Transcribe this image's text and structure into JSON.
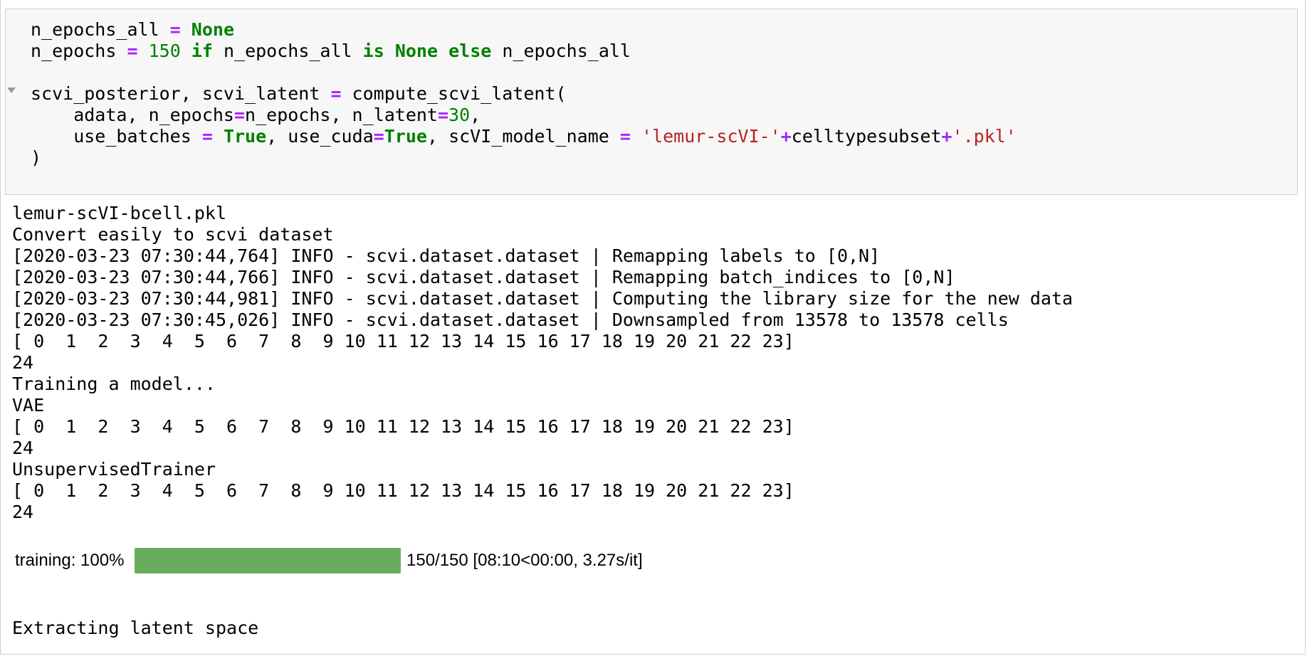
{
  "input": {
    "lines": [
      [
        {
          "t": "n_epochs_all "
        },
        {
          "t": "=",
          "c": "op"
        },
        {
          "t": " "
        },
        {
          "t": "None",
          "c": "kw"
        }
      ],
      [
        {
          "t": "n_epochs "
        },
        {
          "t": "=",
          "c": "op"
        },
        {
          "t": " "
        },
        {
          "t": "150",
          "c": "num"
        },
        {
          "t": " "
        },
        {
          "t": "if",
          "c": "kw"
        },
        {
          "t": " n_epochs_all "
        },
        {
          "t": "is",
          "c": "kw"
        },
        {
          "t": " "
        },
        {
          "t": "None",
          "c": "kw"
        },
        {
          "t": " "
        },
        {
          "t": "else",
          "c": "kw"
        },
        {
          "t": " n_epochs_all"
        }
      ],
      [],
      [
        {
          "t": "scvi_posterior, scvi_latent "
        },
        {
          "t": "=",
          "c": "op"
        },
        {
          "t": " compute_scvi_latent("
        }
      ],
      [
        {
          "t": "    adata, n_epochs"
        },
        {
          "t": "=",
          "c": "op"
        },
        {
          "t": "n_epochs, n_latent"
        },
        {
          "t": "=",
          "c": "op"
        },
        {
          "t": "30",
          "c": "num"
        },
        {
          "t": ","
        }
      ],
      [
        {
          "t": "    use_batches "
        },
        {
          "t": "=",
          "c": "op"
        },
        {
          "t": " "
        },
        {
          "t": "True",
          "c": "kw"
        },
        {
          "t": ", use_cuda"
        },
        {
          "t": "=",
          "c": "op"
        },
        {
          "t": "True",
          "c": "kw"
        },
        {
          "t": ", scVI_model_name "
        },
        {
          "t": "=",
          "c": "op"
        },
        {
          "t": " "
        },
        {
          "t": "'lemur-scVI-'",
          "c": "str"
        },
        {
          "t": "+",
          "c": "op"
        },
        {
          "t": "celltypesubset"
        },
        {
          "t": "+",
          "c": "op"
        },
        {
          "t": "'.pkl'",
          "c": "str"
        }
      ],
      [
        {
          "t": ")"
        }
      ]
    ]
  },
  "output": {
    "lines": [
      "lemur-scVI-bcell.pkl",
      "Convert easily to scvi dataset",
      "[2020-03-23 07:30:44,764] INFO - scvi.dataset.dataset | Remapping labels to [0,N]",
      "[2020-03-23 07:30:44,766] INFO - scvi.dataset.dataset | Remapping batch_indices to [0,N]",
      "[2020-03-23 07:30:44,981] INFO - scvi.dataset.dataset | Computing the library size for the new data",
      "[2020-03-23 07:30:45,026] INFO - scvi.dataset.dataset | Downsampled from 13578 to 13578 cells",
      "[ 0  1  2  3  4  5  6  7  8  9 10 11 12 13 14 15 16 17 18 19 20 21 22 23]",
      "24",
      "Training a model...",
      "VAE",
      "[ 0  1  2  3  4  5  6  7  8  9 10 11 12 13 14 15 16 17 18 19 20 21 22 23]",
      "24",
      "UnsupervisedTrainer",
      "[ 0  1  2  3  4  5  6  7  8  9 10 11 12 13 14 15 16 17 18 19 20 21 22 23]",
      "24"
    ],
    "final_line": "Extracting latent space"
  },
  "progress": {
    "label": "training: 100%",
    "fraction": 1.0,
    "info": "150/150 [08:10<00:00, 3.27s/it]",
    "color": "#67ac5b"
  }
}
